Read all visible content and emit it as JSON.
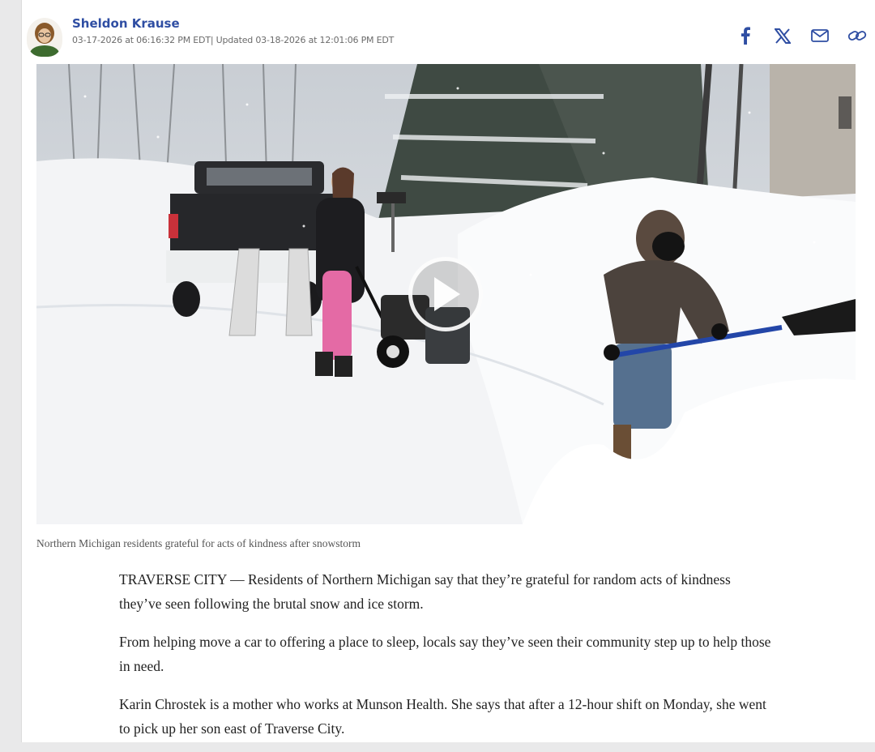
{
  "author": {
    "name": "Sheldon Krause",
    "timestamp": "03-17-2026 at 06:16:32 PM EDT| Updated 03-18-2026 at 12:01:06 PM EDT"
  },
  "share": {
    "icons": [
      "facebook-icon",
      "x-icon",
      "email-icon",
      "link-icon"
    ],
    "color": "#2f4ea3"
  },
  "media": {
    "type": "video",
    "caption": "Northern Michigan residents grateful for acts of kindness after snowstorm"
  },
  "article": {
    "paragraphs": [
      "TRAVERSE CITY — Residents of Northern Michigan say that they’re grateful for random acts of kindness they’ve seen following the brutal snow and ice storm.",
      "From helping move a car to offering a place to sleep, locals say they’ve seen their community step up to help those in need.",
      "Karin Chrostek is a mother who works at Munson Health. She says that after a 12-hour shift on Monday, she went to pick up her son east of Traverse City."
    ]
  }
}
